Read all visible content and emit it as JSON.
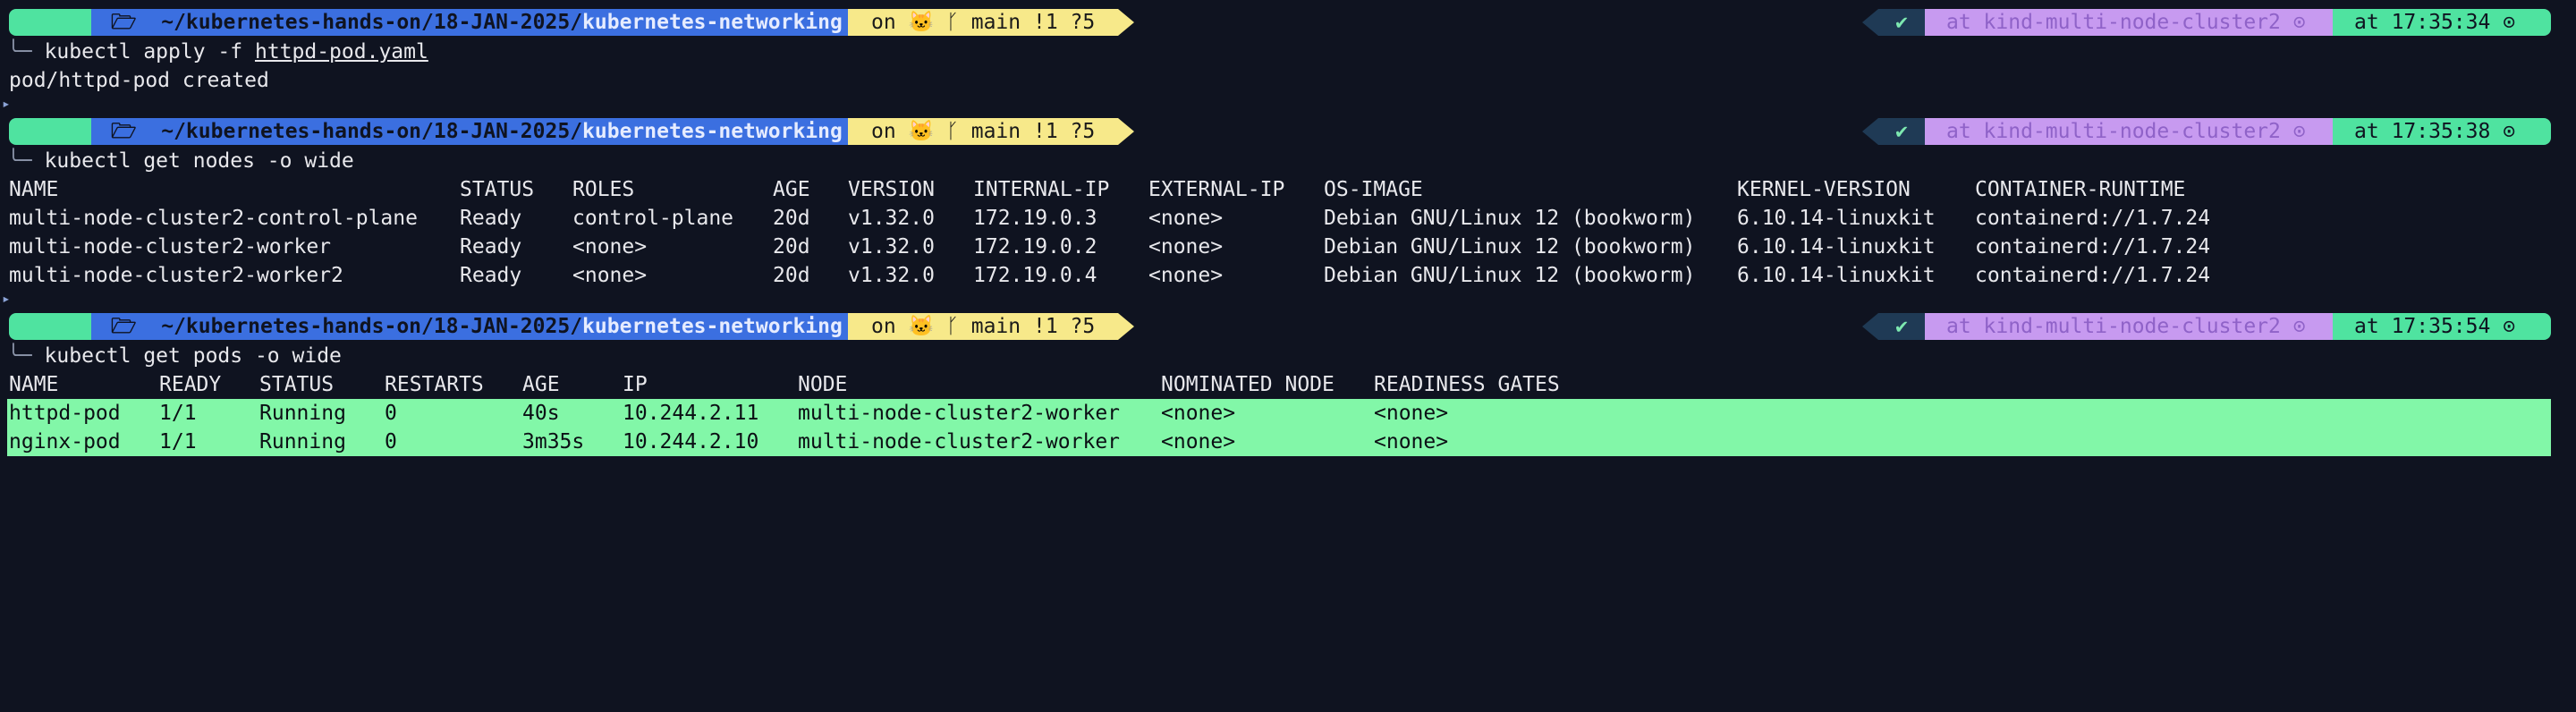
{
  "prompt": {
    "apple_glyph": "",
    "folder_glyph": "🗁",
    "path_home": "~/kubernetes-hands-on/",
    "path_mid": "18-JAN-2025/",
    "path_dir": "kubernetes-networking",
    "git_on": "on",
    "git_icon": "🐱",
    "branch_icon": "ᚴ",
    "branch": "main !1 ?5",
    "check": "✔",
    "context": "at kind-multi-node-cluster2",
    "context_icon": "⊙",
    "time_prefix": "at",
    "clock_icon": "⊙",
    "times": [
      "17:35:34",
      "17:35:38",
      "17:35:54"
    ]
  },
  "caret": "▸",
  "branch_line": "╰─",
  "blocks": [
    {
      "command": "kubectl apply -f ",
      "command_arg": "httpd-pod.yaml",
      "output": "pod/httpd-pod created"
    },
    {
      "command": "kubectl get nodes -o wide",
      "headers": [
        "NAME",
        "STATUS",
        "ROLES",
        "AGE",
        "VERSION",
        "INTERNAL-IP",
        "EXTERNAL-IP",
        "OS-IMAGE",
        "KERNEL-VERSION",
        "CONTAINER-RUNTIME"
      ],
      "rows": [
        [
          "multi-node-cluster2-control-plane",
          "Ready",
          "control-plane",
          "20d",
          "v1.32.0",
          "172.19.0.3",
          "<none>",
          "Debian GNU/Linux 12 (bookworm)",
          "6.10.14-linuxkit",
          "containerd://1.7.24"
        ],
        [
          "multi-node-cluster2-worker",
          "Ready",
          "<none>",
          "20d",
          "v1.32.0",
          "172.19.0.2",
          "<none>",
          "Debian GNU/Linux 12 (bookworm)",
          "6.10.14-linuxkit",
          "containerd://1.7.24"
        ],
        [
          "multi-node-cluster2-worker2",
          "Ready",
          "<none>",
          "20d",
          "v1.32.0",
          "172.19.0.4",
          "<none>",
          "Debian GNU/Linux 12 (bookworm)",
          "6.10.14-linuxkit",
          "containerd://1.7.24"
        ]
      ]
    },
    {
      "command": "kubectl get pods -o wide",
      "headers": [
        "NAME",
        "READY",
        "STATUS",
        "RESTARTS",
        "AGE",
        "IP",
        "NODE",
        "NOMINATED NODE",
        "READINESS GATES"
      ],
      "rows": [
        [
          "httpd-pod",
          "1/1",
          "Running",
          "0",
          "40s",
          "10.244.2.11",
          "multi-node-cluster2-worker",
          "<none>",
          "<none>"
        ],
        [
          "nginx-pod",
          "1/1",
          "Running",
          "0",
          "3m35s",
          "10.244.2.10",
          "multi-node-cluster2-worker",
          "<none>",
          "<none>"
        ]
      ]
    }
  ]
}
